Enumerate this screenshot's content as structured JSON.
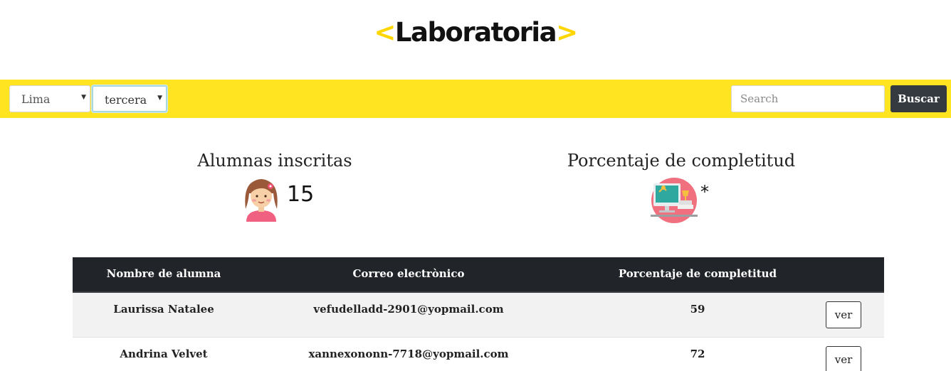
{
  "brand": {
    "open": "<",
    "name": "Laboratoria",
    "close": ">",
    "accent": "#ffd600"
  },
  "filters": {
    "city": "Lima",
    "generation": "tercera"
  },
  "search": {
    "placeholder": "Search",
    "button": "Buscar"
  },
  "stats": {
    "enrolled": {
      "title": "Alumnas inscritas",
      "value": "15",
      "icon": "girl-avatar-icon"
    },
    "completion": {
      "title": "Porcentaje de completitud",
      "value": "*",
      "icon": "desk-computer-icon"
    }
  },
  "table": {
    "headers": [
      "Nombre de alumna",
      "Correo electrònico",
      "Porcentaje de completitud"
    ],
    "rows": [
      {
        "name": "Laurissa Natalee",
        "email": "vefudelladd-2901@yopmail.com",
        "pct": "59",
        "action": "ver"
      },
      {
        "name": "Andrina Velvet",
        "email": "xannexononn-7718@yopmail.com",
        "pct": "72",
        "action": "ver"
      }
    ]
  },
  "colors": {
    "toolbar": "#ffe521",
    "header_bg": "#212529",
    "button_dark": "#343a40"
  }
}
